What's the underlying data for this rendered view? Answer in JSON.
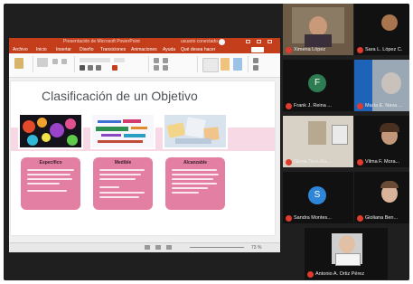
{
  "app": {
    "window_title": "Presentación de Microsoft PowerPoint",
    "user": "usuario conectado"
  },
  "ribbon_tabs": [
    "Archivo",
    "Inicio",
    "Insertar",
    "Diseño",
    "Transiciones",
    "Animaciones",
    "Ayuda",
    "Qué desea hacer"
  ],
  "slide": {
    "title": "Clasificación de un Objetivo",
    "cards": [
      {
        "heading": "Específico"
      },
      {
        "heading": "Medible"
      },
      {
        "heading": "Alcanzable"
      }
    ]
  },
  "status": {
    "zoom": "73 %"
  },
  "participants": [
    {
      "name": "Ximena López"
    },
    {
      "name": "Sara L. López C."
    },
    {
      "name": "Frank J. Reina ..."
    },
    {
      "name": "María E. Nava ..."
    },
    {
      "name": "Gloria Teco Ra..."
    },
    {
      "name": "Vilma F. Mora..."
    },
    {
      "name": "Sandra Montes..."
    },
    {
      "name": "Gioliana Ben..."
    },
    {
      "name": "Antonio A. Ortiz Pérez"
    }
  ],
  "colors": {
    "powerpoint_red": "#c43e1c",
    "card_pink": "#e27fa3",
    "band_pink": "#f6d9e4",
    "mic_muted": "#e03b2c",
    "avatar_green": "#2e7d52",
    "avatar_blue": "#2f86d8"
  }
}
